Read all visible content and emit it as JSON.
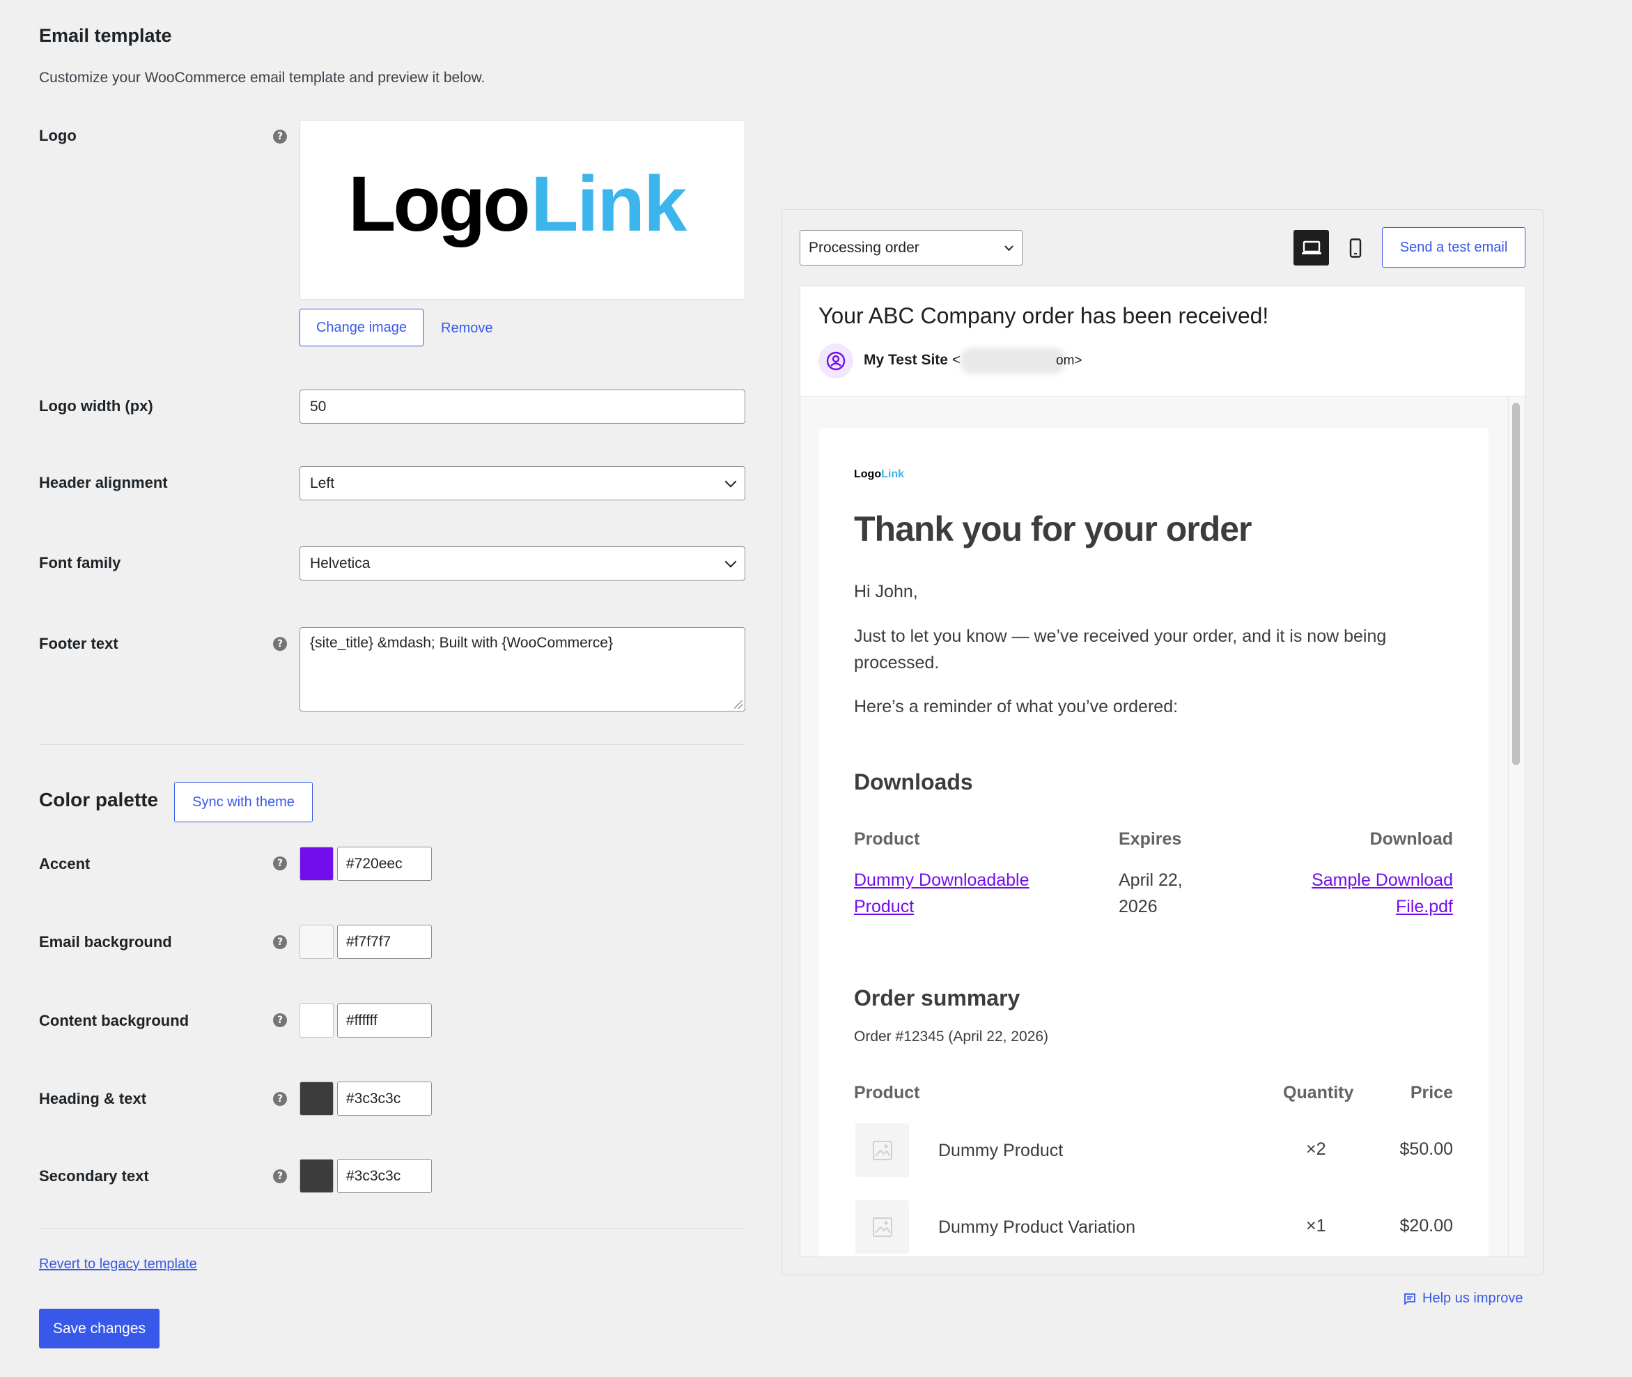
{
  "page": {
    "title": "Email template",
    "description": "Customize your WooCommerce email template and preview it below."
  },
  "logo": {
    "label": "Logo",
    "logo_text_dark": "Logo",
    "logo_text_light": "Link",
    "change_label": "Change image",
    "remove_label": "Remove"
  },
  "fields": {
    "logo_width": {
      "label": "Logo width (px)",
      "value": "50"
    },
    "header_alignment": {
      "label": "Header alignment",
      "value": "Left"
    },
    "font_family": {
      "label": "Font family",
      "value": "Helvetica"
    },
    "footer_text": {
      "label": "Footer text",
      "value": "{site_title} &mdash; Built with {WooCommerce}"
    }
  },
  "palette": {
    "title": "Color palette",
    "sync_label": "Sync with theme",
    "colors": [
      {
        "label": "Accent",
        "hex": "#720eec"
      },
      {
        "label": "Email background",
        "hex": "#f7f7f7"
      },
      {
        "label": "Content background",
        "hex": "#ffffff"
      },
      {
        "label": "Heading & text",
        "hex": "#3c3c3c"
      },
      {
        "label": "Secondary text",
        "hex": "#3c3c3c"
      }
    ]
  },
  "actions": {
    "revert_label": "Revert to legacy template",
    "save_label": "Save changes"
  },
  "preview": {
    "email_type": "Processing order",
    "send_test_label": "Send a test email",
    "subject": "Your ABC Company order has been received!",
    "sender_name": "My Test Site",
    "sender_open": "<",
    "sender_tail": "om>",
    "help_label": "Help us improve",
    "email": {
      "logo_dark": "Logo",
      "logo_light": "Link",
      "heading": "Thank you for your order",
      "greeting": "Hi John,",
      "intro_line1": "Just to let you know — we’ve received your order, and it is now being",
      "intro_line2": "processed.",
      "reminder": "Here’s a reminder of what you’ve ordered:",
      "downloads_title": "Downloads",
      "downloads_headers": {
        "product": "Product",
        "expires": "Expires",
        "download": "Download"
      },
      "download_row": {
        "product_line1": "Dummy Downloadable",
        "product_line2": "Product",
        "expires_line1": "April 22,",
        "expires_line2": "2026",
        "file_line1": "Sample Download",
        "file_line2": "File.pdf"
      },
      "summary_title": "Order summary",
      "order_meta": "Order #12345 (April 22, 2026)",
      "summary_headers": {
        "product": "Product",
        "quantity": "Quantity",
        "price": "Price"
      },
      "items": [
        {
          "name": "Dummy Product",
          "qty": "×2",
          "price": "$50.00"
        },
        {
          "name": "Dummy Product Variation",
          "qty": "×1",
          "price": "$20.00"
        }
      ]
    }
  },
  "colors": {
    "admin_accent": "#3858e9",
    "logo_dark": "#000000",
    "logo_light": "#3cb4ec"
  }
}
